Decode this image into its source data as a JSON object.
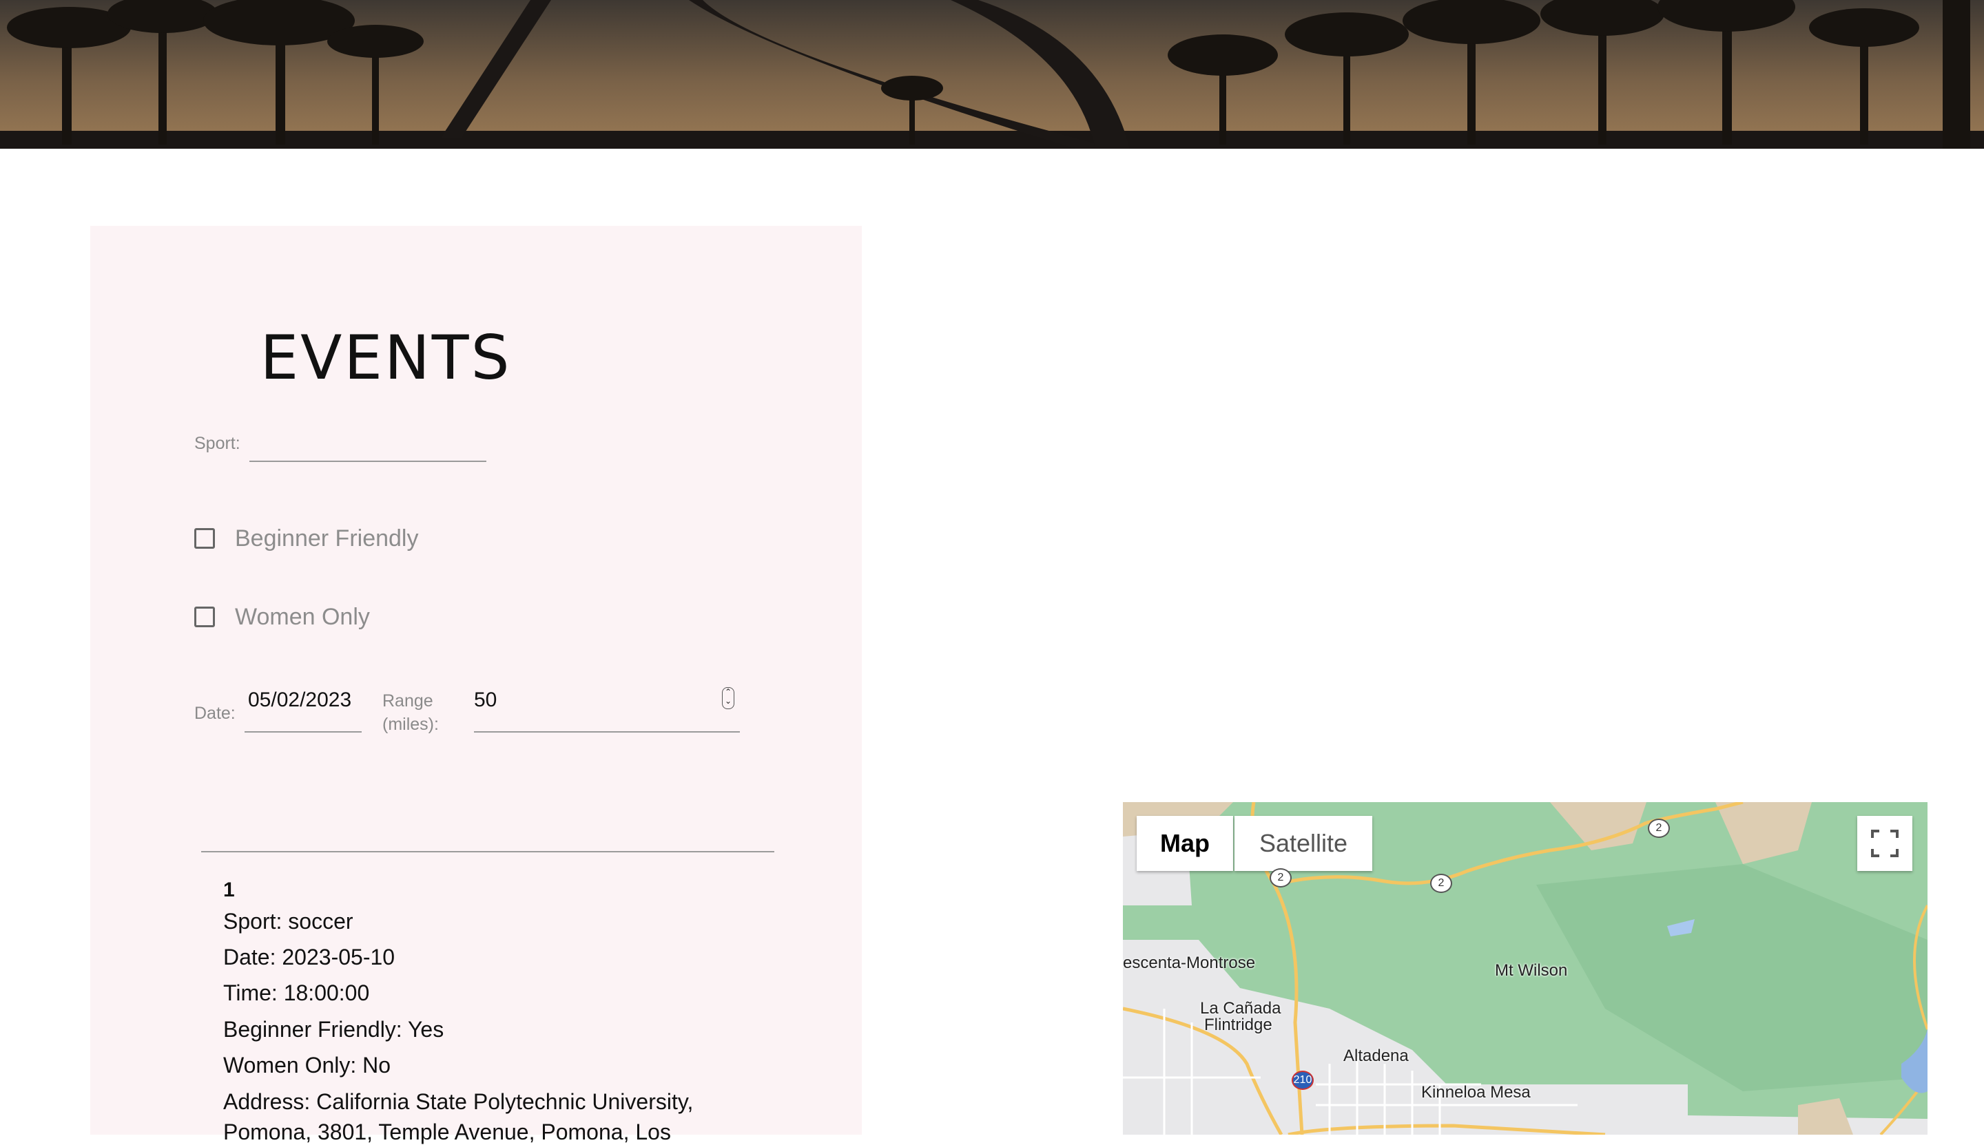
{
  "events": {
    "title": "EVENTS",
    "sport_label": "Sport:",
    "sport_value": "",
    "beginner_label": "Beginner Friendly",
    "women_label": "Women Only",
    "date_label": "Date:",
    "date_value": "05/02/2023",
    "range_label_line1": "Range",
    "range_label_line2": "(miles):",
    "range_value": "50",
    "list": [
      {
        "number": "1",
        "sport": "Sport: soccer",
        "date": "Date: 2023-05-10",
        "time": "Time: 18:00:00",
        "beginner": "Beginner Friendly: Yes",
        "women": "Women Only: No",
        "address_line1": "Address: California State Polytechnic University,",
        "address_line2": "Pomona, 3801, Temple Avenue, Pomona, Los"
      }
    ]
  },
  "map": {
    "map_button": "Map",
    "satellite_button": "Satellite",
    "labels": {
      "crescenta": "escenta-Montrose",
      "la_canada1": "La Cañada",
      "la_canada2": "Flintridge",
      "mt_wilson": "Mt Wilson",
      "altadena": "Altadena",
      "kinneloa": "Kinneloa Mesa"
    },
    "shields": [
      "2",
      "2",
      "2",
      "210"
    ]
  }
}
